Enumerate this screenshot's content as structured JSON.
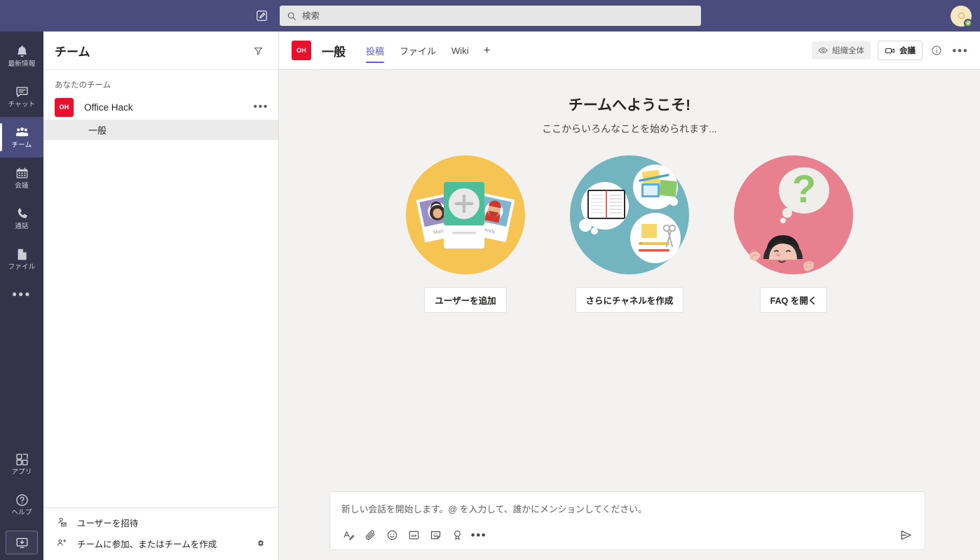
{
  "topbar": {
    "compose_icon": "compose-pencil-icon",
    "search": {
      "placeholder": "検索",
      "value": "",
      "icon": "search-icon"
    },
    "avatar": {
      "icon": "user-avatar",
      "presence": "available",
      "presence_color": "#92c353"
    },
    "background_color": "#4b4c7e"
  },
  "rail": {
    "background_color": "#33344a",
    "active_color": "#4b4c7e",
    "items": [
      {
        "label": "最新情報",
        "icon": "bell-icon",
        "active": false
      },
      {
        "label": "チャット",
        "icon": "chat-icon",
        "active": false
      },
      {
        "label": "チーム",
        "icon": "teams-people-icon",
        "active": true
      },
      {
        "label": "会議",
        "icon": "calendar-icon",
        "active": false
      },
      {
        "label": "通話",
        "icon": "phone-icon",
        "active": false
      },
      {
        "label": "ファイル",
        "icon": "file-icon",
        "active": false
      }
    ],
    "more_label": "•••",
    "bottom_items": [
      {
        "label": "アプリ",
        "icon": "apps-grid-icon"
      },
      {
        "label": "ヘルプ",
        "icon": "help-question-icon"
      }
    ],
    "download_icon": "download-desktop-app-icon"
  },
  "teams_panel": {
    "title": "チーム",
    "filter_icon": "filter-funnel-icon",
    "group_label": "あなたのチーム",
    "team": {
      "initials": "OH",
      "name": "Office Hack",
      "avatar_color": "#e8112d",
      "more_icon": "•••"
    },
    "channels": [
      {
        "name": "一般",
        "active": true
      }
    ],
    "footer": [
      {
        "label": "ユーザーを招待",
        "icon": "invite-person-icon"
      },
      {
        "label": "チームに参加、またはチームを作成",
        "icon": "join-create-team-icon"
      }
    ],
    "settings_icon": "gear-icon"
  },
  "channel_header": {
    "team_initials": "OH",
    "channel_name": "一般",
    "tabs": [
      {
        "label": "投稿",
        "active": true
      },
      {
        "label": "ファイル",
        "active": false
      },
      {
        "label": "Wiki",
        "active": false
      }
    ],
    "add_tab_label": "+",
    "org_badge": {
      "label": "組織全体",
      "icon": "eye-icon"
    },
    "meet_button": {
      "label": "会議",
      "icon": "video-camera-icon"
    },
    "info_icon": "info-circle-icon",
    "more_icon": "•••",
    "accent_color": "#5b5fc7"
  },
  "welcome": {
    "title": "チームへようこそ!",
    "subtitle": "ここからいろんなことを始められます...",
    "cards": [
      {
        "art": "add-users-illustration",
        "circle_color": "#f6c453",
        "button_label": "ユーザーを追加"
      },
      {
        "art": "create-channels-illustration",
        "circle_color": "#72b5c0",
        "button_label": "さらにチャネルを作成"
      },
      {
        "art": "open-faq-illustration",
        "circle_color": "#e8808f",
        "button_label": "FAQ を開く"
      }
    ]
  },
  "compose": {
    "placeholder": "新しい会話を開始します。@ を入力して、誰かにメンションしてください。",
    "value": "",
    "tools": [
      {
        "name": "format-text-icon",
        "glyph": "A"
      },
      {
        "name": "attach-file-icon"
      },
      {
        "name": "emoji-icon"
      },
      {
        "name": "giphy-icon",
        "glyph": "GIF"
      },
      {
        "name": "sticker-icon"
      },
      {
        "name": "praise-icon"
      },
      {
        "name": "more-options-icon",
        "glyph": "•••"
      }
    ],
    "send_icon": "send-icon"
  }
}
